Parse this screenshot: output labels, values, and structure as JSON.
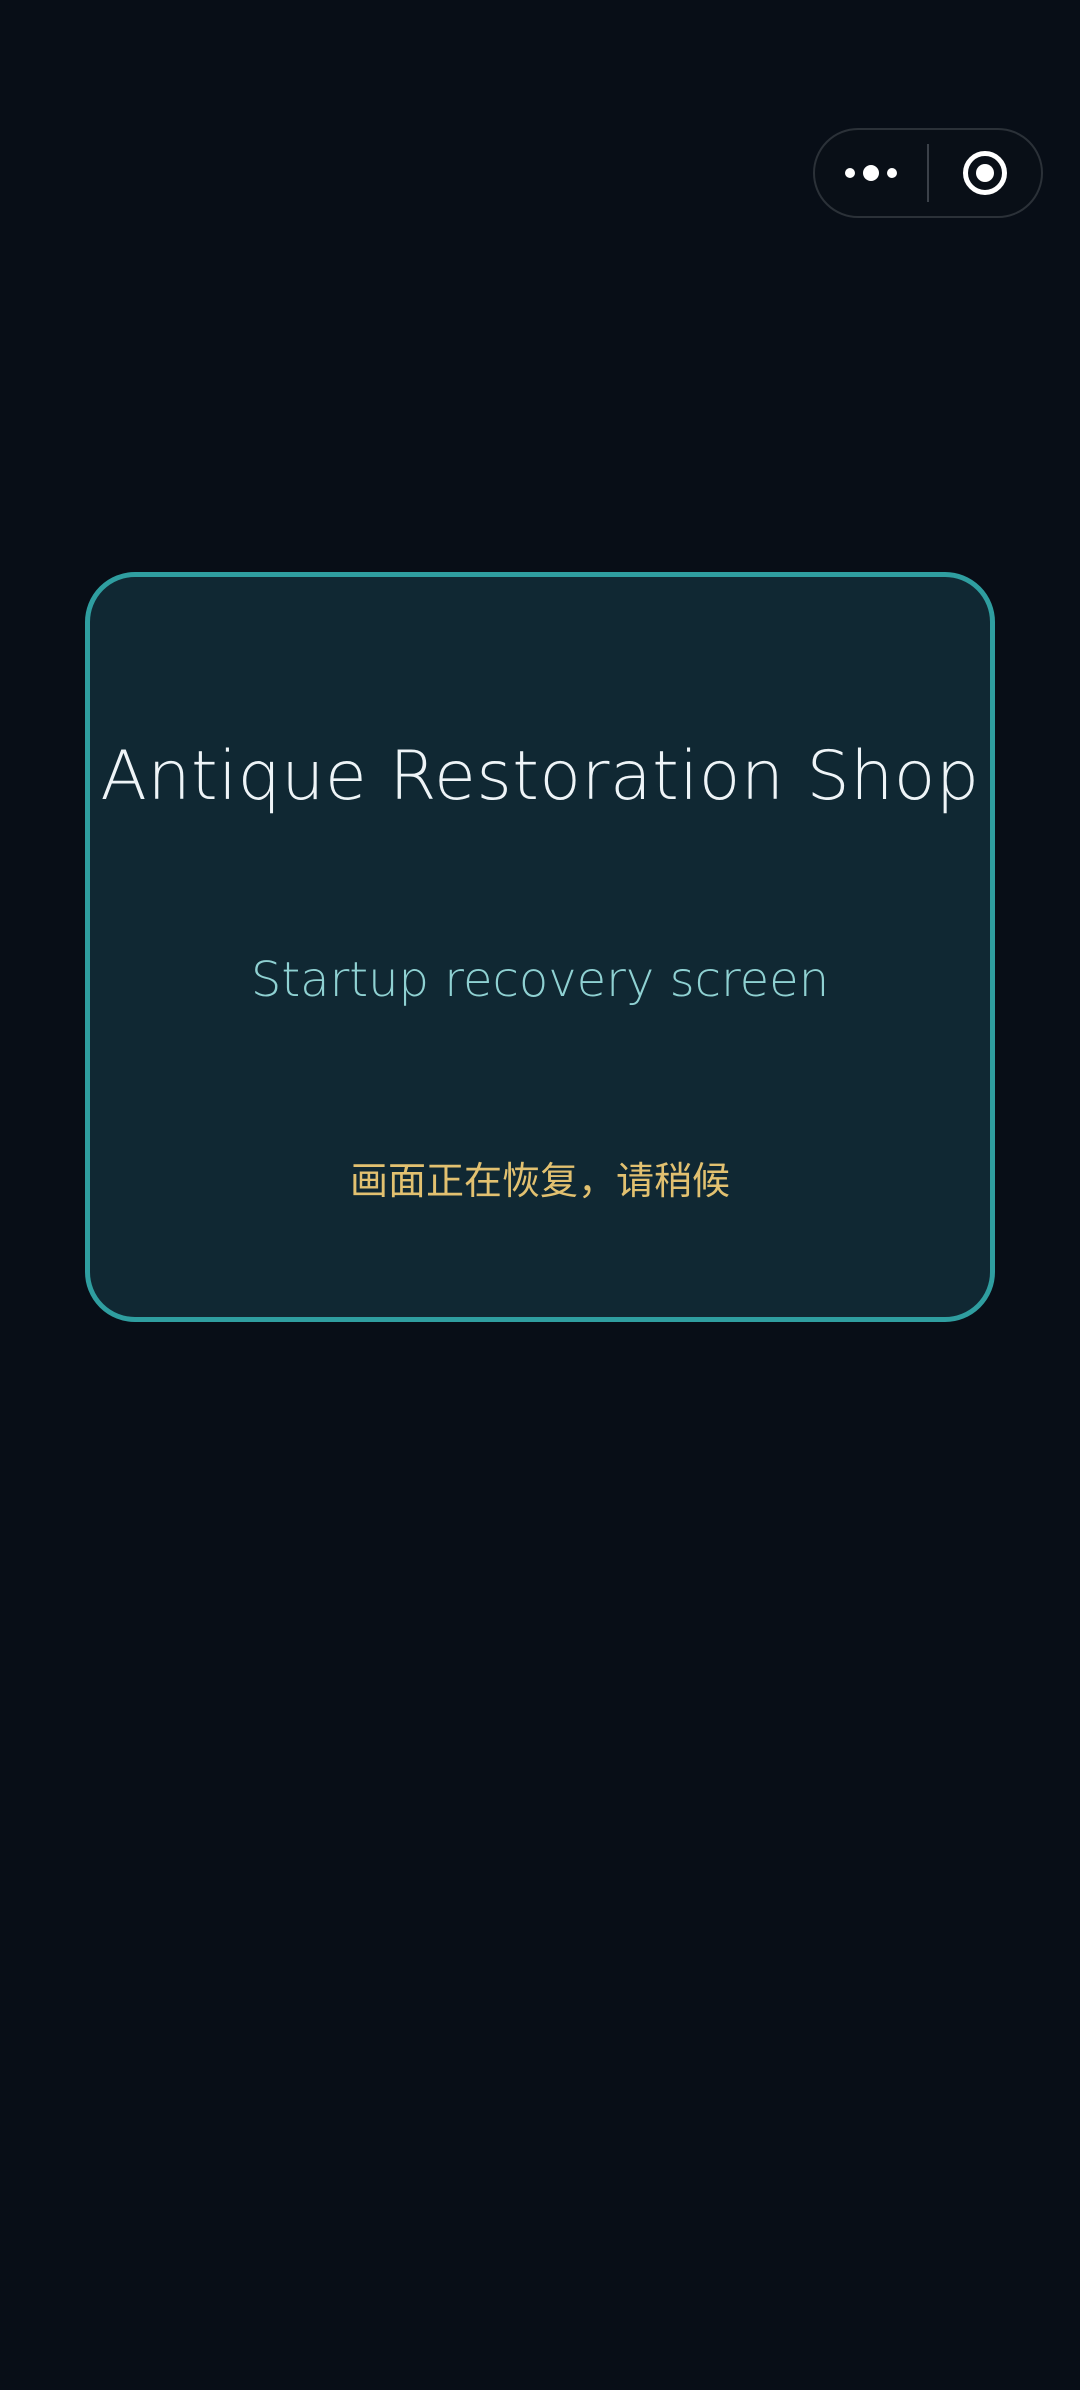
{
  "capsule": {
    "more_icon": "more-dots-icon",
    "close_icon": "target-circle-icon"
  },
  "card": {
    "title": "Antique Restoration Shop",
    "subtitle": "Startup recovery screen",
    "status": "画面正在恢复，请稍候"
  },
  "colors": {
    "background": "#080e17",
    "card_background": "#102833",
    "card_border": "#2f9ea0",
    "title": "#eef4f7",
    "subtitle": "#8fd1d2",
    "status": "#e2c170"
  }
}
